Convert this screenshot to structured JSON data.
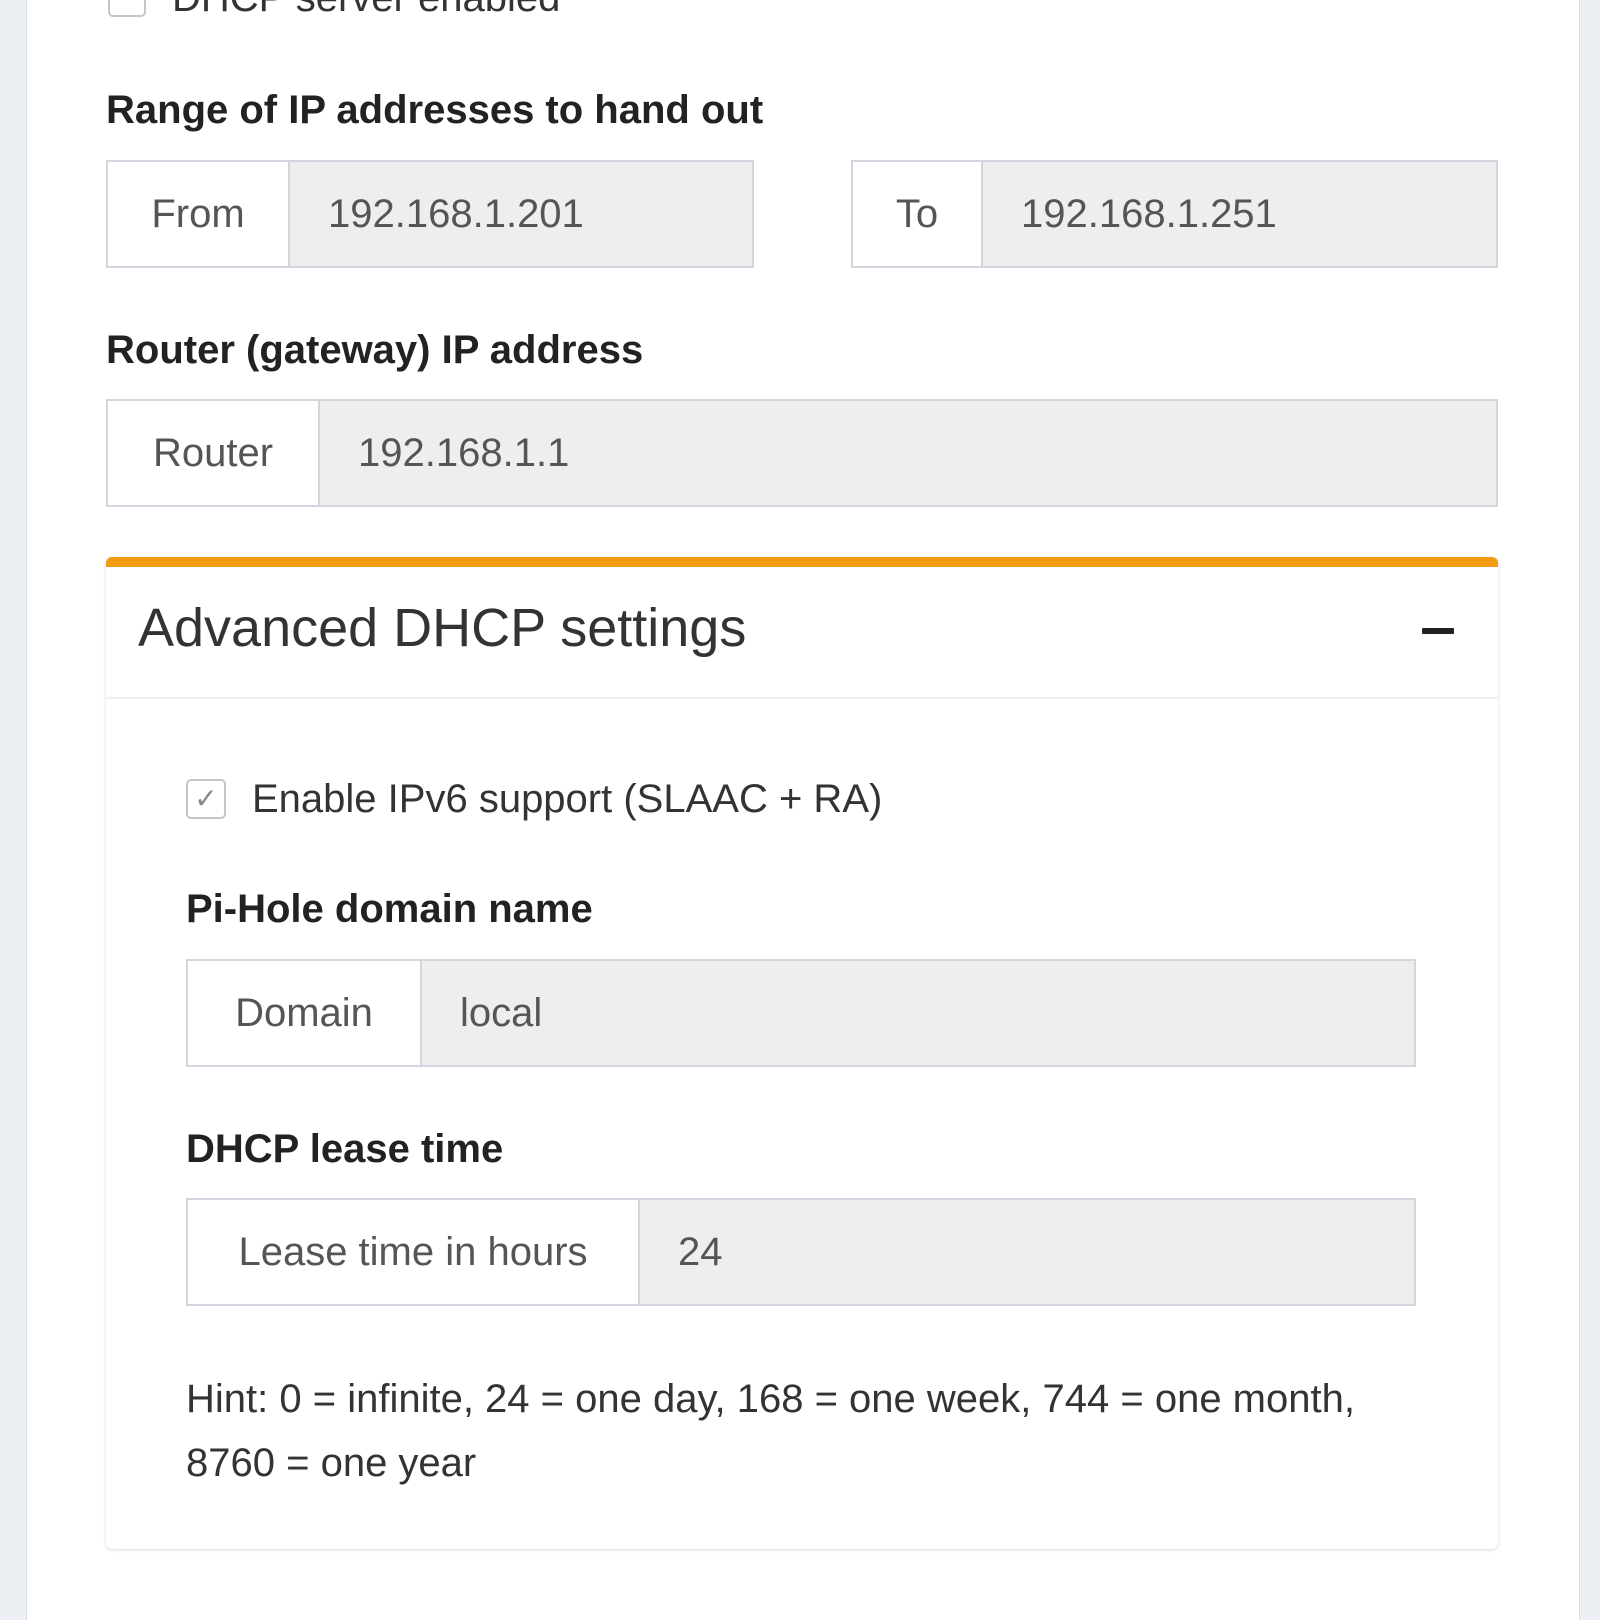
{
  "dhcp_server": {
    "enabled_label": "DHCP server enabled",
    "enabled": false
  },
  "range": {
    "title": "Range of IP addresses to hand out",
    "from_label": "From",
    "from_value": "192.168.1.201",
    "to_label": "To",
    "to_value": "192.168.1.251"
  },
  "router": {
    "title": "Router (gateway) IP address",
    "label": "Router",
    "value": "192.168.1.1"
  },
  "advanced": {
    "title": "Advanced DHCP settings",
    "collapse_icon": "minus-icon",
    "accent_color": "#f39c12",
    "ipv6": {
      "label": "Enable IPv6 support (SLAAC + RA)",
      "checked": true
    },
    "domain": {
      "title": "Pi-Hole domain name",
      "label": "Domain",
      "value": "local"
    },
    "lease": {
      "title": "DHCP lease time",
      "label": "Lease time in hours",
      "value": "24",
      "hint": "Hint: 0 = infinite, 24 = one day, 168 = one week, 744 = one month, 8760 = one year"
    }
  }
}
